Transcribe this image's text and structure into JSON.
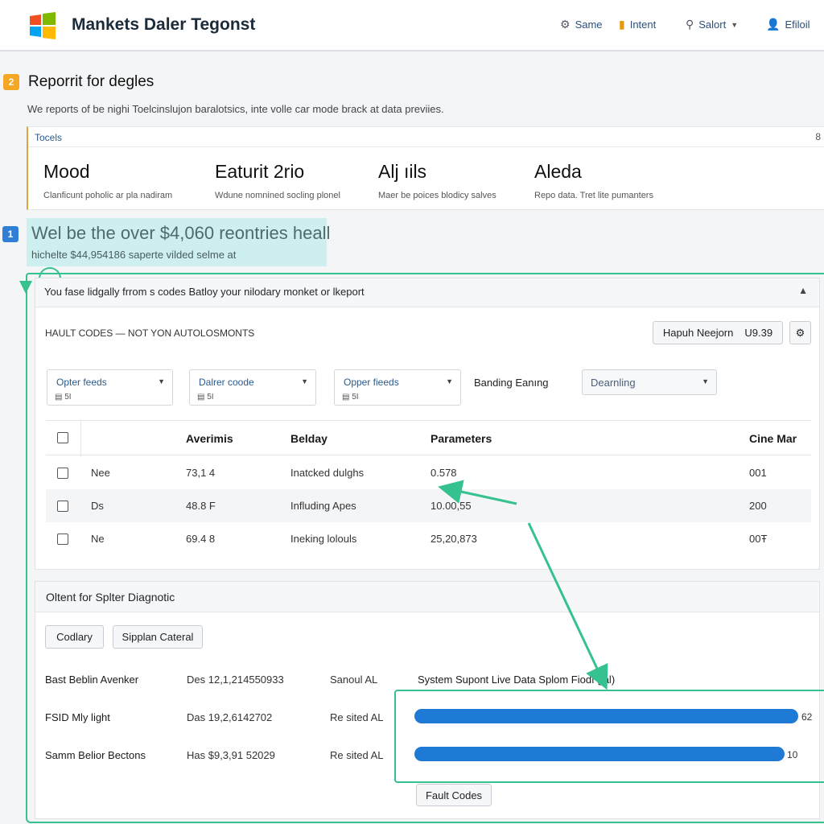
{
  "header": {
    "app_title": "Mankets Daler Tegonst",
    "nav": [
      {
        "icon": "gear-icon",
        "label": "Same"
      },
      {
        "icon": "document-icon",
        "label": "Intent"
      },
      {
        "icon": "user-icon",
        "label": "Salort"
      },
      {
        "icon": "profile-icon",
        "label": "Efiloil"
      }
    ]
  },
  "report": {
    "number": "2",
    "title": "Reporrit for degles",
    "description": "We reports of be nighi Toelcinslujon baralotsics, inte volle car mode brack at data previies.",
    "tools_label": "Tocels",
    "tools_count": "8",
    "stats": [
      {
        "value": "Mood",
        "sub": "Clanficunt poholic ar pla nadiram"
      },
      {
        "value": "Eaturit 2rio",
        "sub": "Wdune nomnined socling plonel"
      },
      {
        "value": "Alj ıils",
        "sub": "Maer be poices blodicy salves"
      },
      {
        "value": "Aleda",
        "sub": "Repo data. Tret lite pumanters"
      }
    ]
  },
  "highlight": {
    "number": "1",
    "text": "Wel be the over $4,060 reontries heall",
    "sub": "hichelte $44,954186 saperte vilded selme at"
  },
  "panel": {
    "title": "You fase lidgally frrom s codes Batloy your nilodary monket or lkeport",
    "subtitle": "HAULT CODES — NOT YON AUTOLOSMONTS",
    "report_button": "Hapuh Neejorn",
    "report_value": "U9.39",
    "dropdowns": [
      {
        "label": "Opter feeds",
        "small": "▤ 5I"
      },
      {
        "label": "Dalrer coode",
        "small": "▤ 5I"
      },
      {
        "label": "Opper fieeds",
        "small": "▤ 5I"
      }
    ],
    "filter_label": "Banding Eanıng",
    "select_value": "Dearnling"
  },
  "table": {
    "columns": [
      "Averimis",
      "Belday",
      "Parameters",
      "Cine Mar"
    ],
    "rows": [
      {
        "name": "Nee",
        "avg": "73,1 4",
        "belday": "Inatcked dulghs",
        "params": "0.578",
        "cine": "001"
      },
      {
        "name": "Ds",
        "avg": "48.8 F",
        "belday": "Influding Apes",
        "params": "10.00,55",
        "cine": "200"
      },
      {
        "name": "Ne",
        "avg": "69.4 8",
        "belday": "Ineking lolouls",
        "params": "25,20,873",
        "cine": "00Ŧ"
      }
    ]
  },
  "diagnostic": {
    "title": "Oltent for Splter Diagnotic",
    "buttons": [
      "Codlary",
      "Sipplan Cateral"
    ],
    "chart_header": "System Supont Live Data Splom Fiodı ɮal)",
    "rows": [
      {
        "label": "Bast Beblin Avenker",
        "date": "Des 12,1,214550933",
        "status": "Sanoul AL"
      },
      {
        "label": "FSID Mly light",
        "date": "Das 19,2,6142702",
        "status": "Re sited AL"
      },
      {
        "label": "Samm Belior Bectons",
        "date": "Has $9,3,91 52029",
        "status": "Re sited AL"
      }
    ],
    "bars": [
      {
        "value": 62,
        "label": "62"
      },
      {
        "value": 10,
        "label": "10"
      }
    ],
    "fault_button": "Fault Codes"
  },
  "colors": {
    "accent_green": "#35c28e",
    "bar_blue": "#1f7ad6",
    "badge_orange": "#f5a623",
    "badge_blue": "#2f7fd6",
    "highlight_bg": "#cdeff0"
  }
}
